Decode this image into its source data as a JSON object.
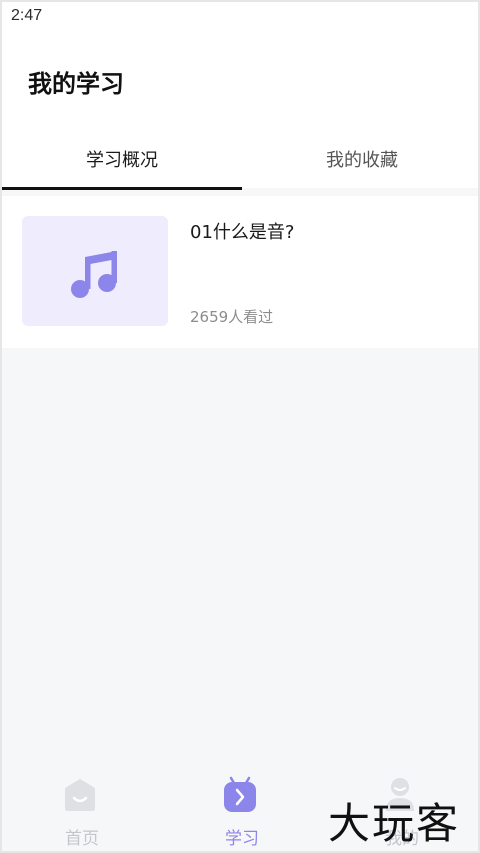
{
  "status_bar": {
    "time": "2:47"
  },
  "header": {
    "title": "我的学习"
  },
  "tabs": [
    {
      "label": "学习概况",
      "selected": true
    },
    {
      "label": "我的收藏",
      "selected": false
    }
  ],
  "lessons": [
    {
      "title": "01什么是音?",
      "views": "2659人看过",
      "thumbnail_icon": "music-note-icon"
    }
  ],
  "bottom_nav": [
    {
      "label": "首页",
      "icon": "home-icon",
      "active": false
    },
    {
      "label": "学习",
      "icon": "learn-icon",
      "active": true
    },
    {
      "label": "我的",
      "icon": "profile-icon",
      "active": false
    }
  ],
  "watermark": "大玩客",
  "colors": {
    "accent": "#8d86ea",
    "thumbnail_bg": "#eeecfd",
    "inactive_nav": "#c4c6cc",
    "page_bg": "#f6f7f9"
  }
}
